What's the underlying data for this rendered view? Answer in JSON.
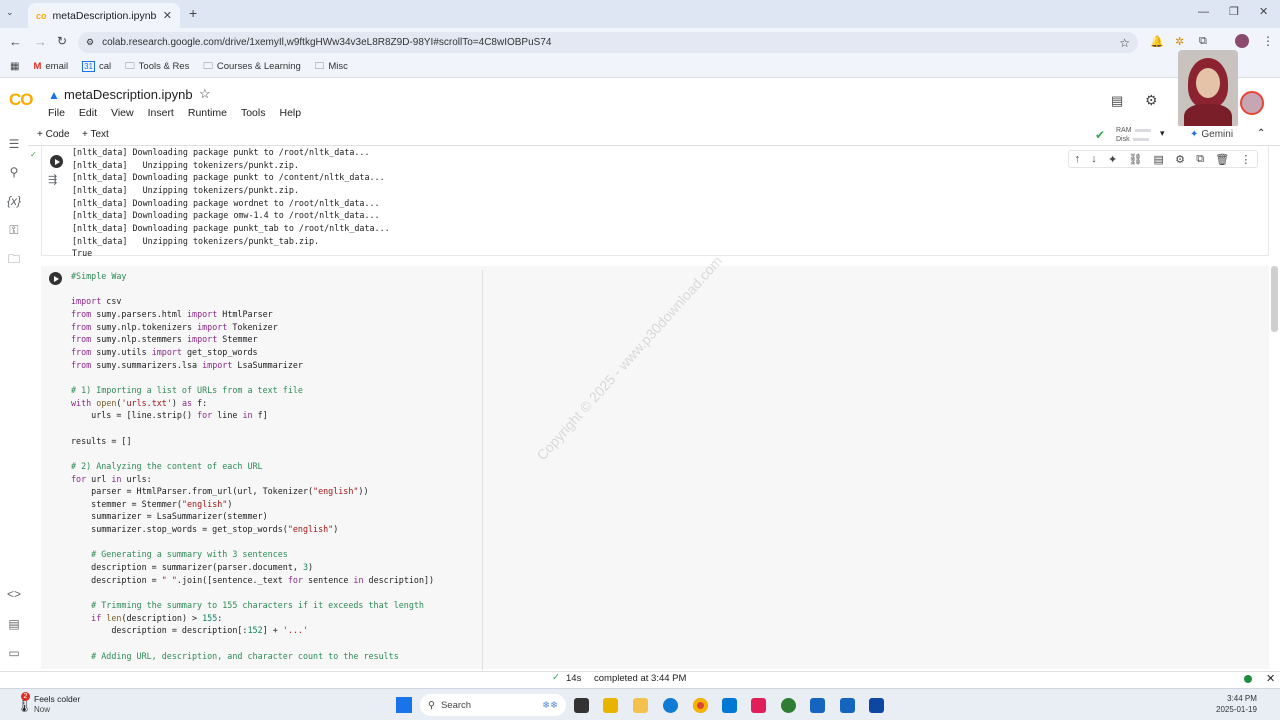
{
  "browser": {
    "tab_title": "metaDescription.ipynb - Colab",
    "url": "colab.research.google.com/drive/1xemyIl,w9ftkgHWw34v3eL8R8Z9D-98YI#scrollTo=4C8wIOBPuS74",
    "bookmarks": [
      "email",
      "cal",
      "Tools & Res",
      "Courses & Learning",
      "Misc"
    ]
  },
  "colab": {
    "logo": "CO",
    "notebook_title": "metaDescription.ipynb",
    "menus": [
      "File",
      "Edit",
      "View",
      "Insert",
      "Runtime",
      "Tools",
      "Help"
    ],
    "add_code": "+ Code",
    "add_text": "+ Text",
    "ram_label": "RAM",
    "disk_label": "Disk",
    "gemini": "Gemini"
  },
  "output_lines": [
    "[nltk_data] Downloading package punkt to /root/nltk_data...",
    "[nltk_data]   Unzipping tokenizers/punkt.zip.",
    "[nltk_data] Downloading package punkt to /content/nltk_data...",
    "[nltk_data]   Unzipping tokenizers/punkt.zip.",
    "[nltk_data] Downloading package wordnet to /root/nltk_data...",
    "[nltk_data] Downloading package omw-1.4 to /root/nltk_data...",
    "[nltk_data] Downloading package punkt_tab to /root/nltk_data...",
    "[nltk_data]   Unzipping tokenizers/punkt_tab.zip.",
    "True"
  ],
  "watermark": "Copyright © 2025 - www.p30download.com",
  "status": {
    "duration": "14s",
    "completed": "completed at 3:44 PM"
  },
  "taskbar": {
    "weather_title": "Feels colder",
    "weather_sub": "Now",
    "weather_badge": "2",
    "search": "Search",
    "time": "3:44 PM",
    "date": "2025-01-19"
  },
  "colors": {
    "accent": "#1a73e8",
    "colab_orange": "#f9ab00"
  }
}
